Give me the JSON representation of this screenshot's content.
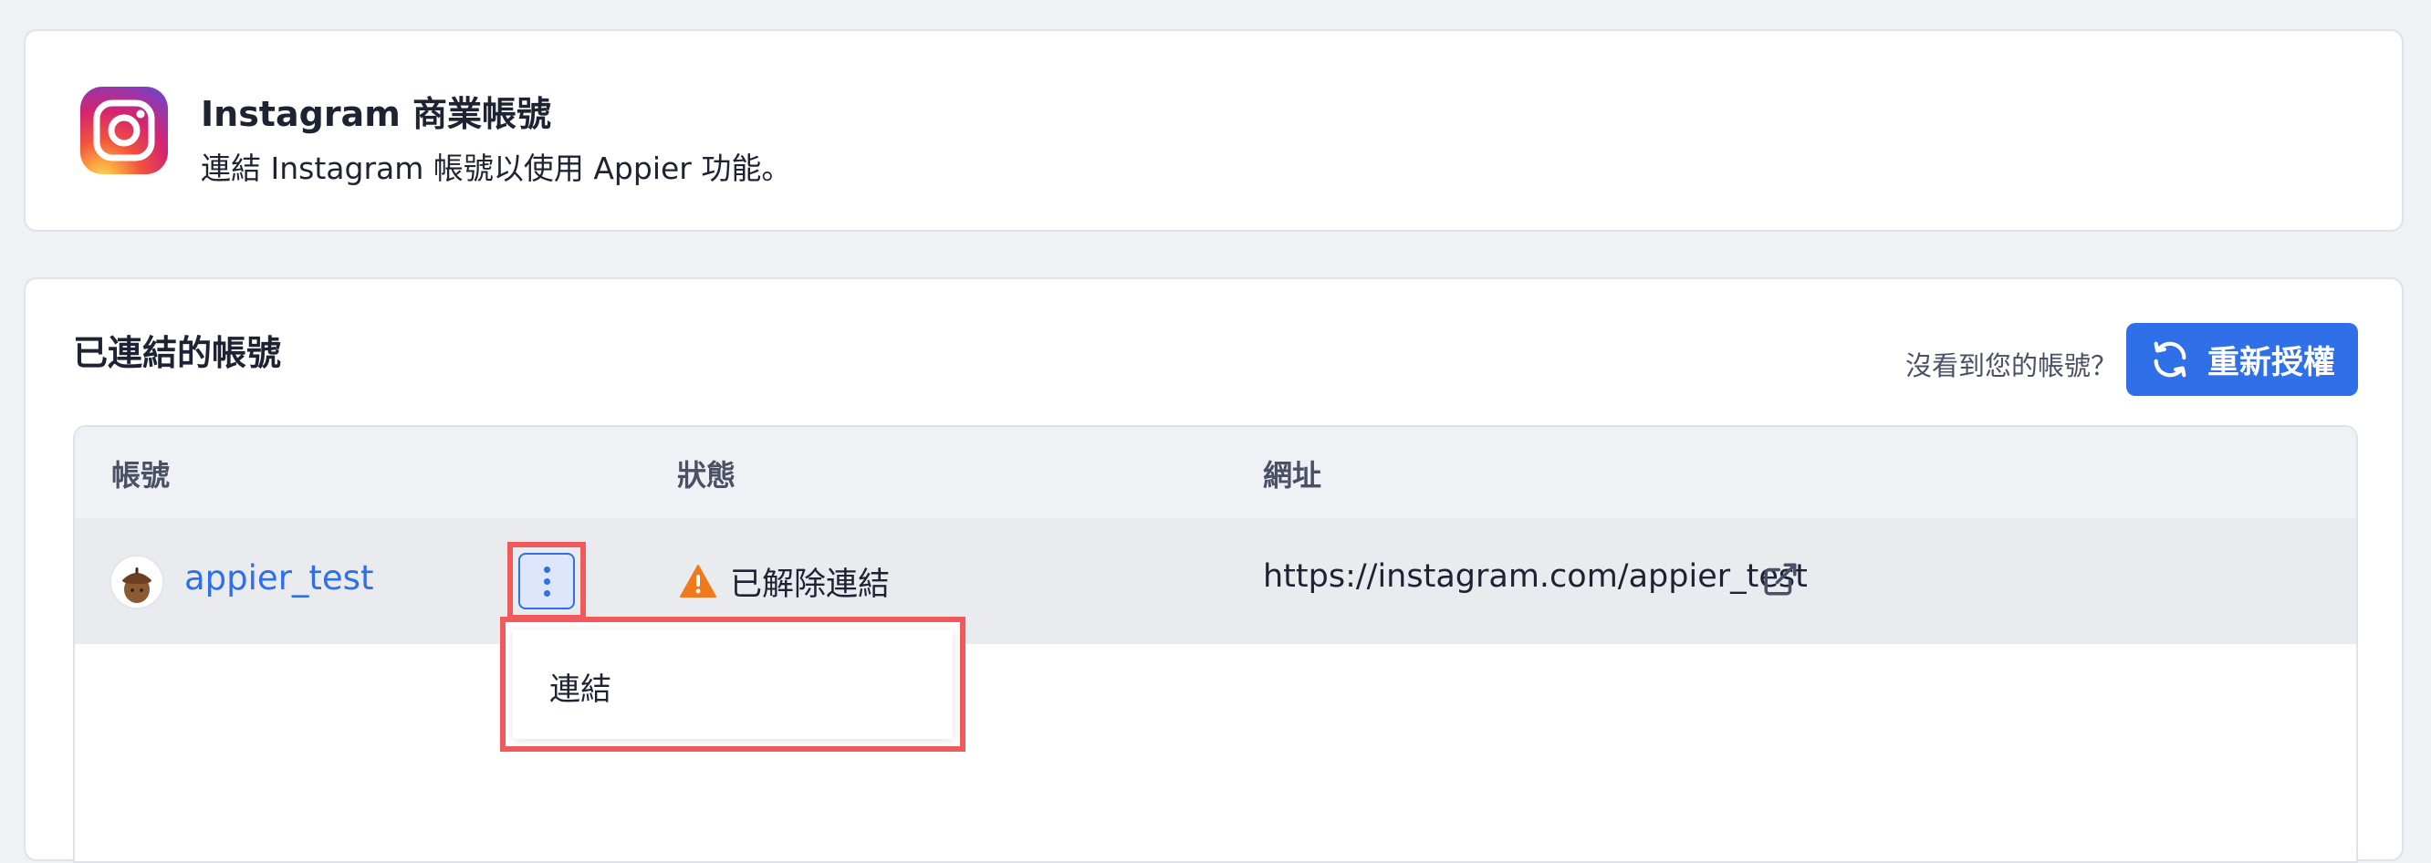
{
  "header": {
    "title": "Instagram 商業帳號",
    "description": "連結 Instagram 帳號以使用 Appier 功能。"
  },
  "accounts": {
    "section_title": "已連結的帳號",
    "not_seen_text": "沒看到您的帳號？",
    "reauth_label": "重新授權",
    "columns": {
      "account": "帳號",
      "status": "狀態",
      "url": "網址"
    },
    "rows": [
      {
        "account": "appier_test",
        "status": "已解除連結",
        "url": "https://instagram.com/appier_test"
      }
    ],
    "menu": {
      "items": [
        "連結"
      ]
    }
  },
  "colors": {
    "accent": "#2f6fe8",
    "highlight": "#f05a5a",
    "warning": "#f07a1a",
    "page_bg": "#f0f1f4"
  },
  "icons": {
    "logo": "instagram-logo-icon",
    "reauth": "refresh-icon",
    "status": "warning-icon",
    "external": "external-link-icon",
    "kebab": "more-vertical-icon"
  }
}
